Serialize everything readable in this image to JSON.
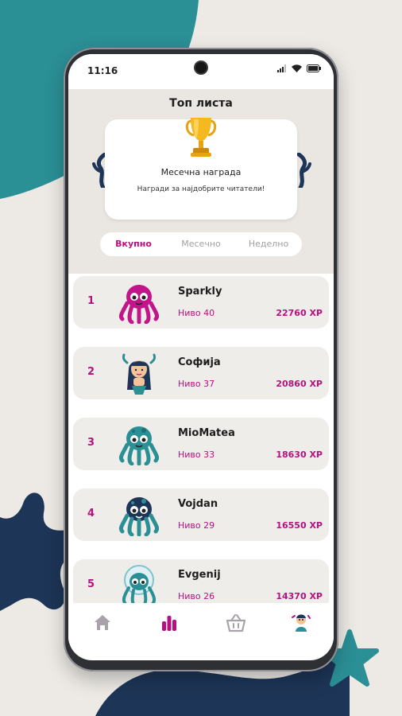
{
  "status": {
    "time": "11:16"
  },
  "header": {
    "title": "Топ листа",
    "award_title": "Месечна награда",
    "award_desc": "Награди за најдобрите читатели!"
  },
  "tabs": [
    {
      "label": "Вкупно",
      "active": true
    },
    {
      "label": "Месечно",
      "active": false
    },
    {
      "label": "Неделно",
      "active": false
    }
  ],
  "leaderboard": [
    {
      "rank": "1",
      "name": "Sparkly",
      "level": "Ниво 40",
      "xp": "22760 XP",
      "avatar": "pink-octopus"
    },
    {
      "rank": "2",
      "name": "Софија",
      "level": "Ниво 37",
      "xp": "20860 XP",
      "avatar": "mermaid-girl"
    },
    {
      "rank": "3",
      "name": "MioMatea",
      "level": "Ниво 33",
      "xp": "18630 XP",
      "avatar": "teal-octopus"
    },
    {
      "rank": "4",
      "name": "Vojdan",
      "level": "Ниво 29",
      "xp": "16550 XP",
      "avatar": "navy-octopus"
    },
    {
      "rank": "5",
      "name": "Evgenij",
      "level": "Ниво 26",
      "xp": "14370 XP",
      "avatar": "diver-octopus"
    }
  ],
  "navbar": [
    {
      "icon": "home-icon"
    },
    {
      "icon": "leaderboard-icon"
    },
    {
      "icon": "shop-basket-icon"
    },
    {
      "icon": "profile-avatar-icon"
    }
  ],
  "colors": {
    "accent": "#b4127f",
    "background": "#edeae5",
    "teal": "#2b8f96",
    "navy": "#1d3557"
  }
}
